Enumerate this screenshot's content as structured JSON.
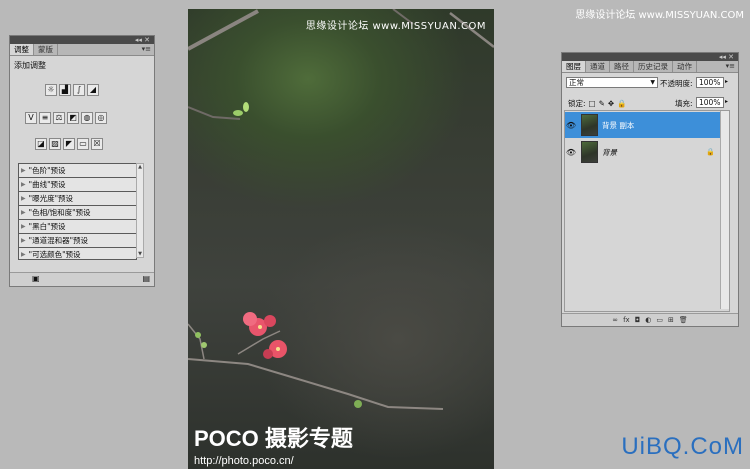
{
  "watermark_top": "思缘设计论坛 www.MISSYUAN.COM",
  "watermark_bottom": "UiBQ.CoM",
  "photo": {
    "brand": "POCO 摄影专题",
    "url": "http://photo.poco.cn/"
  },
  "adjust_panel": {
    "tabs": [
      "调整",
      "蒙版"
    ],
    "heading": "添加调整",
    "icons_row1": [
      "brightness-icon",
      "levels-icon",
      "curves-icon",
      "exposure-icon"
    ],
    "icons_row2": [
      "vibrance-icon",
      "hue-saturation-icon",
      "color-balance-icon",
      "black-white-icon",
      "photo-filter-icon",
      "channel-mixer-icon"
    ],
    "icons_row3": [
      "invert-icon",
      "posterize-icon",
      "threshold-icon",
      "gradient-map-icon",
      "selective-color-icon"
    ],
    "presets": [
      "\"色阶\"预设",
      "\"曲线\"预设",
      "\"曝光度\"预设",
      "\"色相/饱和度\"预设",
      "\"黑白\"预设",
      "\"通道混和器\"预设",
      "\"可选颜色\"预设"
    ]
  },
  "layers_panel": {
    "tabs": [
      "图层",
      "通道",
      "路径",
      "历史记录",
      "动作"
    ],
    "blend_mode": "正常",
    "opacity_label": "不透明度:",
    "opacity_value": "100%",
    "lock_label": "锁定:",
    "fill_label": "填充:",
    "fill_value": "100%",
    "layers": [
      {
        "name": "背景 副本",
        "selected": true
      },
      {
        "name": "背景",
        "selected": false
      }
    ]
  },
  "colors": {
    "selection": "#3d8fd9",
    "watermark_blue": "#2a6fbf"
  }
}
